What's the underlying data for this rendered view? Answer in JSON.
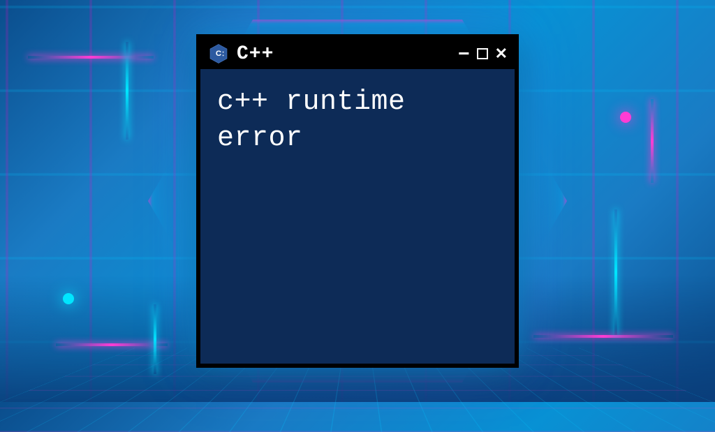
{
  "window": {
    "title": "C++",
    "icon_name": "cpp-hexagon-logo"
  },
  "terminal": {
    "content": "c++ runtime error"
  },
  "colors": {
    "titlebar_bg": "#000000",
    "terminal_bg": "#0d2b57",
    "text": "#ffffff",
    "accent_magenta": "#ff3cd4",
    "accent_cyan": "#00e6ff"
  }
}
